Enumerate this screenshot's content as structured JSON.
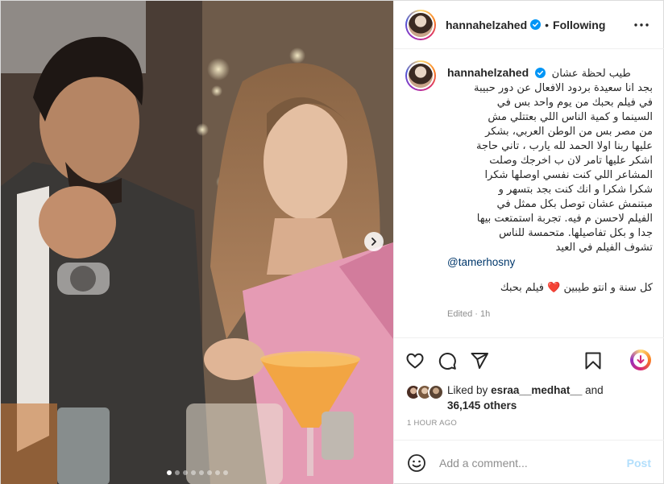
{
  "post": {
    "username": "hannahelzahed",
    "follow_state": "Following",
    "bullet": "•"
  },
  "caption": {
    "username": "hannahelzahed",
    "first_line": "طيب لحظة عشان",
    "body": "بجد انا سعيدة بردود الافعال عن دور حبيبة\nفي فيلم بحبك من يوم واحد بس في\nالسينما و كمية الناس اللي بعتتلي مش\nمن مصر بس من الوطن العربي، بشكر\nعليها ربنا اولا الحمد لله يارب ، تاني حاجة\nاشكر عليها تامر لان ب اخرجك وصلت\nالمشاعر اللي كنت نفسي اوصلها شكرا\nشكرا شكرا و انك كنت بجد بتسهر و\nمبتنمش عشان توصل بكل ممثل في\nالفيلم لاحسن م فيه. تجربة استمتعت بيها\nجدا و بكل تفاصيلها. متحمسة للناس\nتشوف الفيلم في العيد",
    "mention": "@tamerhosny",
    "last_line_a": "كل سنة و انتو طيبين",
    "last_line_heart": "❤️",
    "last_line_b": "فيلم بحبك",
    "edited": "Edited · 1h"
  },
  "likes": {
    "prefix": "Liked by",
    "user": "esraa__medhat__",
    "and": "and",
    "others": "36,145 others"
  },
  "timestamp": "1 HOUR AGO",
  "comment_box": {
    "placeholder": "Add a comment...",
    "post_label": "Post"
  },
  "carousel": {
    "total_slides": 8,
    "current_slide": 1
  },
  "colors": {
    "verified": "#0095f6",
    "link": "#00376b",
    "post_disabled": "#b2dffc",
    "heart": "#e0245e"
  },
  "icons": [
    "more-icon",
    "heart-icon",
    "comment-icon",
    "share-icon",
    "save-icon",
    "download-icon",
    "emoji-icon",
    "chevron-right-icon",
    "verified-badge-icon"
  ]
}
